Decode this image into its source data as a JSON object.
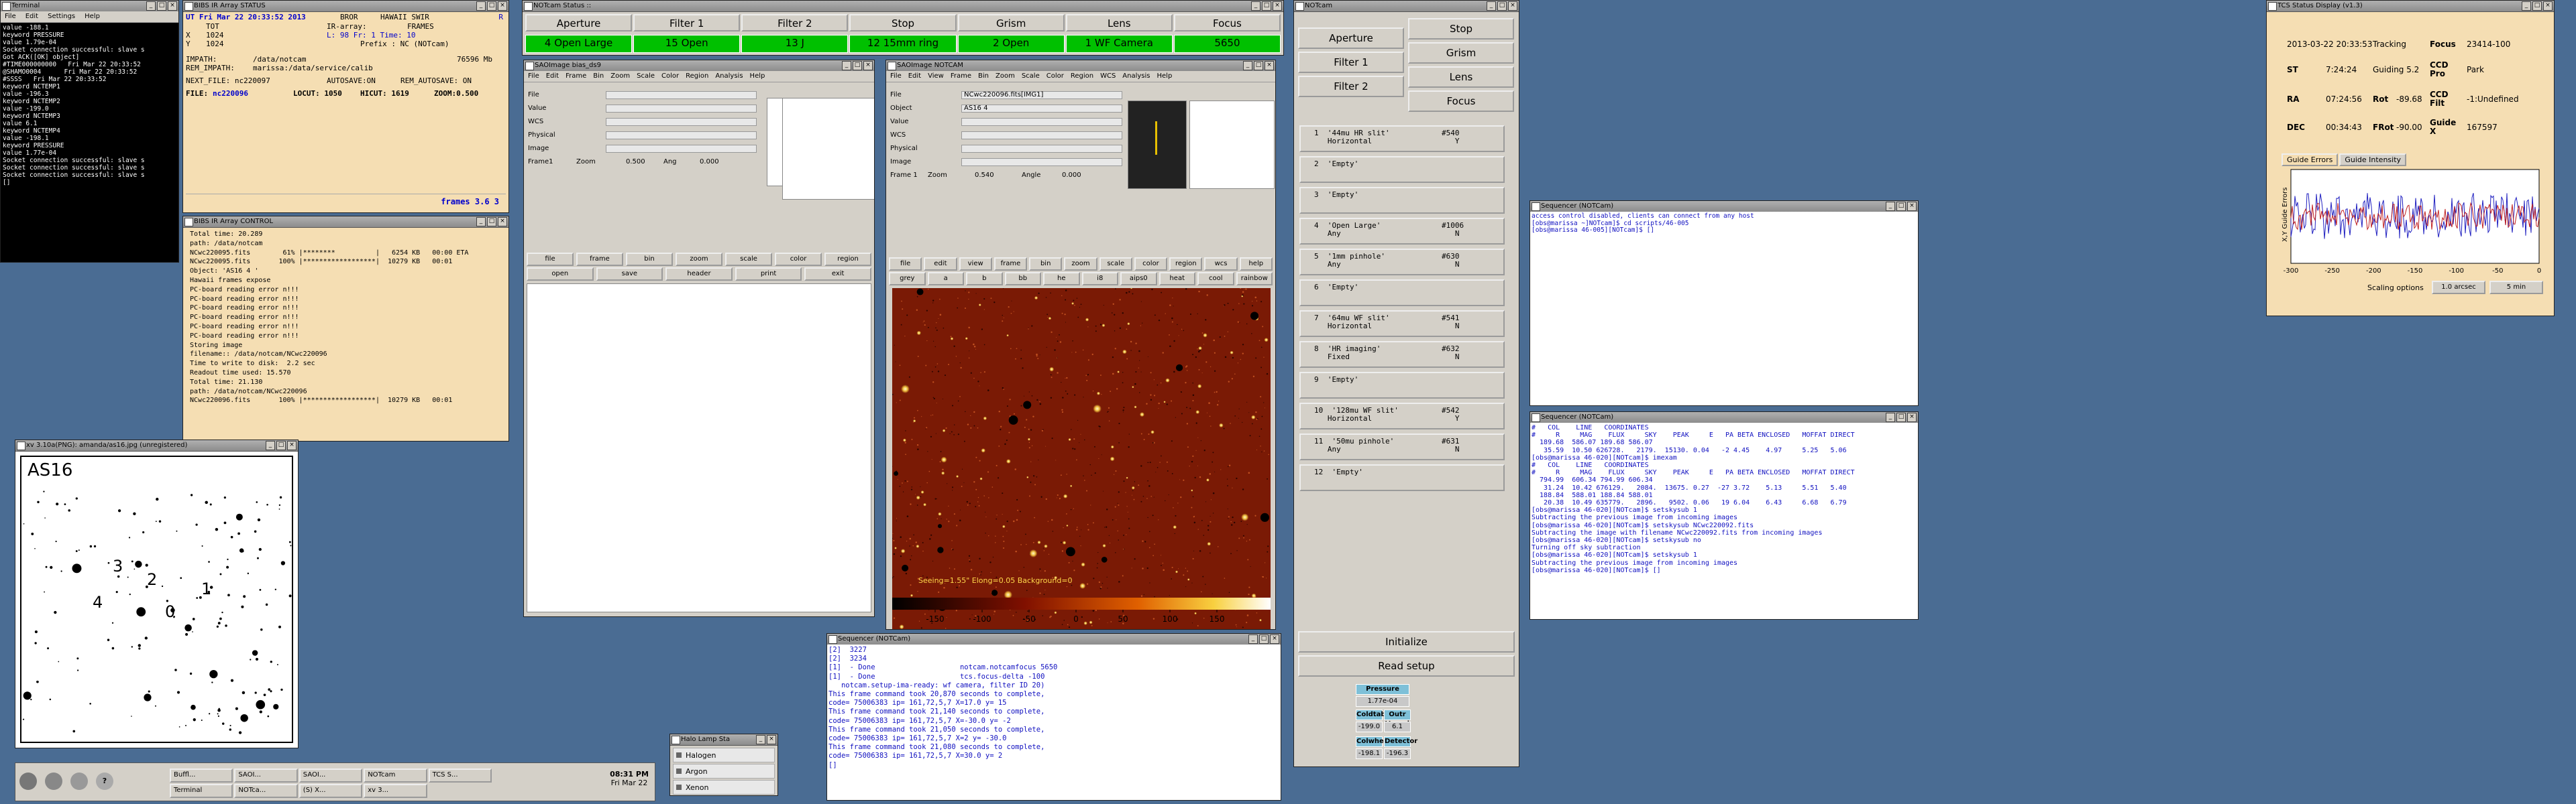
{
  "terminal": {
    "title": "Terminal",
    "menu": [
      "File",
      "Edit",
      "Settings",
      "Help"
    ],
    "lines": [
      "value -188.1",
      "keyword PRESSURE",
      "value 1.79e-04",
      "Socket connection successful: slave s",
      "Got ACK([OK] object]",
      "#TIME000000000   Fri Mar 22 20:33:52",
      "@SHAMO0004      Fri Mar 22 20:33:52",
      "#SSSS   Fri Mar 22 20:33:52",
      "keyword NCTEMP1",
      "value -196.3",
      "keyword NCTEMP2",
      "value -199.0",
      "keyword NCTEMP3",
      "value 6.1",
      "keyword NCTEMP4",
      "value -198.1",
      "keyword PRESSURE",
      "value 1.77e-04",
      "Socket connection successful: slave s",
      "Socket connection successful: slave s",
      "Socket connection successful: slave s",
      "[]"
    ]
  },
  "bibs_status": {
    "title": "BIBS IR Array STATUS",
    "ut": "UT Fri Mar 22 20:33:52 2013",
    "ut_tag": "BROR",
    "ut_right": "HAWAII SWIR",
    "r_flag": "R",
    "l1a": "",
    "l1b": "TOT",
    "l1c": "IR-array:",
    "l1d": "FRAMES",
    "l2a": "X",
    "l2b": "1024",
    "l2c": "L: 98 Fr: 1 Time: 10",
    "l3a": "Y",
    "l3b": "1024",
    "l3c": "Prefix : NC (NOTcam)",
    "impath_label": "IMPATH:",
    "impath": "/data/notcam",
    "impath_size": "76596 Mb",
    "remimpath_label": "REM_IMPATH:",
    "remimpath": "marissa:/data/service/calib",
    "next_file": "NEXT_FILE: nc220097",
    "autosave": "AUTOSAVE:ON",
    "rem_autosave": "REM_AUTOSAVE: ON",
    "file_label": "FILE:",
    "file": "nc220096",
    "locut": "LOCUT: 1050",
    "hicut": "HICUT: 1619",
    "zoom": "ZOOM:0.500",
    "frames": "frames 3.6 3"
  },
  "bibs_control": {
    "title": "BIBS IR Array CONTROL",
    "lines": [
      "Total time: 20.289",
      "path: /data/notcam",
      "NCwc220095.fits        61% |********          |   6254 KB   00:00 ETA",
      "NCwc220095.fits       100% |******************|  10279 KB   00:01",
      "Object: 'AS16 4 '",
      "Hawaii frames expose",
      "PC-board reading error n!!!",
      "PC-board reading error n!!!",
      "PC-board reading error n!!!",
      "PC-board reading error n!!!",
      "PC-board reading error n!!!",
      "PC-board reading error n!!!",
      "",
      "Storing image",
      "filename:: /data/notcam/NCwc220096",
      "Time to write to disk:  2.2 sec",
      "",
      "Readout time used: 15.570",
      "Total time: 21.130",
      "path: /data/notcam/NCwc220096",
      "NCwc220096.fits       100% |******************|  10279 KB   00:01"
    ]
  },
  "xv": {
    "title": "xv 3.10a(PNG): amanda/as16.jpg (unregistered)",
    "field_label": "AS16",
    "star_labels": [
      "3",
      "2",
      "1",
      "4",
      "0"
    ]
  },
  "notcam_status": {
    "title": "NOTcam Status ::",
    "headers": [
      "Aperture",
      "Filter 1",
      "Filter 2",
      "Stop",
      "Grism",
      "Lens",
      "Focus"
    ],
    "values": [
      "4 Open Large",
      "15 Open",
      "13 J",
      "12 15mm ring",
      "2 Open",
      "1 WF Camera",
      "5650"
    ]
  },
  "ds9_small": {
    "title": "SAOImage bias_ds9",
    "menu": [
      "File",
      "Edit",
      "Frame",
      "Bin",
      "Zoom",
      "Scale",
      "Color",
      "Region",
      "Analysis",
      "Help"
    ],
    "labels": [
      "File",
      "Value",
      "WCS",
      "Physical",
      "Image",
      "Frame1"
    ],
    "zoom_label": "Zoom",
    "zoom": "0.500",
    "ang_label": "Ang",
    "ang": "0.000",
    "buttons1": [
      "file",
      "frame",
      "bin",
      "zoom",
      "scale",
      "color",
      "region"
    ],
    "buttons2": [
      "open",
      "save",
      "header",
      "print",
      "exit"
    ]
  },
  "ds9_main": {
    "title": "SAOImage NOTCAM",
    "menu": [
      "File",
      "Edit",
      "View",
      "Frame",
      "Bin",
      "Zoom",
      "Scale",
      "Color",
      "Region",
      "WCS",
      "Analysis",
      "Help"
    ],
    "file": "NCwc220096.fits[IMG1]",
    "object": "AS16 4",
    "labels": [
      "File",
      "Object",
      "Value",
      "WCS",
      "Physical",
      "Image",
      "Frame 1"
    ],
    "zoom_label": "Zoom",
    "zoom": "0.540",
    "angle_label": "Angle",
    "angle": "0.000",
    "buttons1": [
      "file",
      "edit",
      "view",
      "frame",
      "bin",
      "zoom",
      "scale",
      "color",
      "region",
      "wcs",
      "help"
    ],
    "buttons2": [
      "grey",
      "a",
      "b",
      "bb",
      "he",
      "i8",
      "aips0",
      "heat",
      "cool",
      "rainbow"
    ],
    "seeing": "Seeing=1.55\" Elong=0.05 Background=0",
    "colorbar_ticks": [
      "-150",
      "-100",
      "-50",
      "0",
      "50",
      "100",
      "150"
    ]
  },
  "sequencer_bottom": {
    "title": "Sequencer (NOTCam)",
    "lines": [
      "[2]  3227",
      "[2]  3234",
      "[1]  - Done                    notcam.notcamfocus 5650",
      "[1]  - Done                    tcs.focus-delta -100",
      "",
      "   notcam.setup-ima-ready: wf camera, filter ID 20)",
      "",
      "This frame command took 20,870 seconds to complete,",
      "code= 75006383 ip= 161,72,5,7 X=17.0 y= 15",
      "This frame command took 21,140 seconds to complete,",
      "code= 75006383 ip= 161,72,5,7 X=-30.0 y= -2",
      "This frame command took 21,050 seconds to complete,",
      "code= 75006383 ip= 161,72,5,7 X=2 y= -30.0",
      "This frame command took 21,080 seconds to complete,",
      "code= 75006383 ip= 161,72,5,7 X=30.0 y= 2",
      "[]"
    ]
  },
  "halogen": {
    "title": "Halo Lamp Sta",
    "items": [
      "Halogen",
      "Argon",
      "Xenon"
    ]
  },
  "taskbar": {
    "items": [
      "Buffl...",
      "SAOI...",
      "SAOI...",
      "NOTcam",
      "TCS S...",
      "Terminal",
      "NOTca...",
      "(S) X...",
      "xv 3..."
    ],
    "time": "08:31 PM",
    "date": "Fri Mar 22"
  },
  "notcam_ctrl": {
    "title": "NOTcam",
    "left_buttons": [
      "Aperture",
      "Filter 1",
      "Filter 2"
    ],
    "right_buttons": [
      "Stop",
      "Grism",
      "Lens",
      "Focus"
    ],
    "slots": [
      {
        "label": "1  '44mu HR slit'\n   Horizontal",
        "code": "#540\n   Y"
      },
      {
        "label": "2  'Empty'",
        "code": ""
      },
      {
        "label": "3  'Empty'",
        "code": ""
      },
      {
        "label": "4  'Open Large'\n   Any",
        "code": "#1006\n   N"
      },
      {
        "label": "5  '1mm pinhole'\n   Any",
        "code": "#630\n   N"
      },
      {
        "label": "6  'Empty'",
        "code": ""
      },
      {
        "label": "7  '64mu WF slit'\n   Horizontal",
        "code": "#541\n   N"
      },
      {
        "label": "8  'HR imaging'\n   Fixed",
        "code": "#632\n   N"
      },
      {
        "label": "9  'Empty'",
        "code": ""
      },
      {
        "label": "10  '128mu WF slit'\n   Horizontal",
        "code": "#542\n   Y"
      },
      {
        "label": "11  '50mu pinhole'\n   Any",
        "code": "#631\n   N"
      },
      {
        "label": "12  'Empty'",
        "code": ""
      }
    ],
    "initialize": "Initialize",
    "readsetup": "Read setup",
    "pressure_label": "Pressure",
    "pressure": "1.77e-04",
    "coldtable_label": "Coldtable",
    "coldtable": "-199.0",
    "outer_label": "Outr Vessel",
    "outer": "6.1",
    "coldwheel_label": "Colwheel",
    "coldwheel": "-198.1",
    "detector_label": "Detector",
    "detector": "-196.3"
  },
  "seq1": {
    "title": "Sequencer (NOTCam)",
    "lines": [
      "access control disabled, clients can connect from any host",
      "[obs@marissa ~]NOTcam]$ cd scripts/46-005",
      "[obs@marissa 46-005][NOTcam]$ []"
    ]
  },
  "seq2": {
    "title": "Sequencer (NOTCam)",
    "lines": [
      "#   COL    LINE   COORDINATES",
      "#     R     MAG    FLUX     SKY    PEAK     E   PA BETA ENCLOSED   MOFFAT DIRECT",
      "  189.68  586.07 189.68 586.07",
      "   35.59  10.50 626728.   2179.  15130. 0.04   -2 4.45    4.97     5.25   5.06",
      "[obs@marissa 46-020][NOTcam]$ imexam",
      "#   COL    LINE   COORDINATES",
      "#     R     MAG    FLUX     SKY    PEAK     E   PA BETA ENCLOSED   MOFFAT DIRECT",
      "  794.99  606.34 794.99 606.34",
      "   31.24  10.42 676129.   2084.  13675. 0.27  -27 3.72    5.13     5.51   5.40",
      "  188.84  588.01 188.84 588.01",
      "   20.38  10.49 635779.   2896.   9502. 0.06   19 6.04    6.43     6.68   6.79",
      "[obs@marissa 46-020][NOTcam]$ setskysub 1",
      "Subtracting the previous image from incoming images",
      "[obs@marissa 46-020][NOTcam]$ setskysub NCwc220092.fits",
      "Subtracting the image with filename NCwc220092.fits from incoming images",
      "[obs@marissa 46-020][NOTcam]$ setskysub no",
      "Turning off sky subtraction",
      "[obs@marissa 46-020][NOTcam]$ setskysub 1",
      "Subtracting the previous image from incoming images",
      "[obs@marissa 46-020][NOTcam]$ []"
    ]
  },
  "tcs": {
    "title": "TCS Status Display (v1.3)",
    "date": "2013-03-22 20:33:53",
    "tracking": "Tracking",
    "focus_label": "Focus",
    "focus": "23414-100",
    "st_label": "ST",
    "st": "7:24:24",
    "guiding": "Guiding 5.2",
    "ccdpro_label": "CCD\nPro",
    "ccdpro": "Park",
    "ra_label": "RA",
    "ra": "07:24:56",
    "rot_label": "Rot",
    "rot": "-89.68",
    "ccdfilt_label": "CCD\nFilt",
    "ccdfilt": "-1:Undefined",
    "dec_label": "DEC",
    "dec": "00:34:43",
    "frot_label": "FRot",
    "frot": "-90.00",
    "guidex_label": "Guide\nX",
    "guidex": "167597",
    "tabs": [
      "Guide Errors",
      "Guide Intensity"
    ],
    "ylabel": "X,Y Guide Errors",
    "xticks": [
      "-300",
      "-250",
      "-200",
      "-150",
      "-100",
      "-50",
      "0"
    ],
    "scaling_label": "Scaling options",
    "scale_opt": "1.0 arcsec",
    "time_opt": "5 min"
  },
  "colors": {
    "status_green": "#00c000",
    "desktop": "#4a6c93",
    "bibs_bg": "#f5deb3"
  }
}
